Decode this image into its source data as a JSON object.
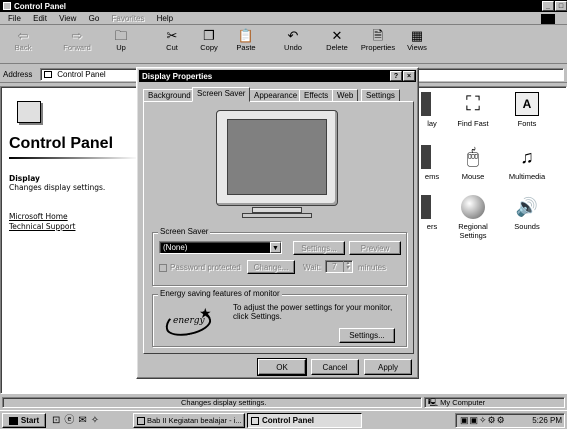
{
  "window": {
    "title": "Control Panel",
    "menu": [
      "File",
      "Edit",
      "View",
      "Go",
      "Favorites",
      "Help"
    ],
    "toolbar": [
      "Back",
      "Forward",
      "Up",
      "Cut",
      "Copy",
      "Paste",
      "Undo",
      "Delete",
      "Properties",
      "Views"
    ],
    "address_label": "Address",
    "address_value": "Control Panel"
  },
  "left_pane": {
    "title": "Control Panel",
    "selected_name": "Display",
    "selected_desc": "Changes display settings.",
    "links": [
      "Microsoft Home",
      "Technical Support"
    ]
  },
  "icons": [
    {
      "label": "lay",
      "icon": "partial-icon"
    },
    {
      "label": "Find Fast",
      "icon": "binoculars-icon"
    },
    {
      "label": "Fonts",
      "icon": "fonts-folder-icon"
    },
    {
      "label": "ems",
      "icon": "partial-icon"
    },
    {
      "label": "Mouse",
      "icon": "mouse-icon"
    },
    {
      "label": "Multimedia",
      "icon": "multimedia-icon"
    },
    {
      "label": "ers",
      "icon": "partial-icon"
    },
    {
      "label": "Regional Settings",
      "icon": "globe-icon"
    },
    {
      "label": "Sounds",
      "icon": "speaker-icon"
    }
  ],
  "status": {
    "text": "Changes display settings.",
    "zone": "My Computer"
  },
  "dialog": {
    "title": "Display Properties",
    "tabs": [
      "Background",
      "Screen Saver",
      "Appearance",
      "Effects",
      "Web",
      "Settings"
    ],
    "active_tab": "Screen Saver",
    "screen_saver_label": "Screen Saver",
    "screen_saver_value": "(None)",
    "settings_btn": "Settings...",
    "preview_btn": "Preview",
    "password_label": "Password protected",
    "change_btn": "Change...",
    "wait_label": "Wait:",
    "wait_value": "7",
    "minutes_label": "minutes",
    "energy_label": "Energy saving features of monitor",
    "energy_text": "To adjust the power settings for your monitor, click Settings.",
    "energy_settings_btn": "Settings...",
    "energy_logo": "energy",
    "ok": "OK",
    "cancel": "Cancel",
    "apply": "Apply"
  },
  "taskbar": {
    "start": "Start",
    "tasks": [
      "Bab II Kegiatan bealajar - i...",
      "Control Panel"
    ],
    "clock": "5:26 PM"
  }
}
